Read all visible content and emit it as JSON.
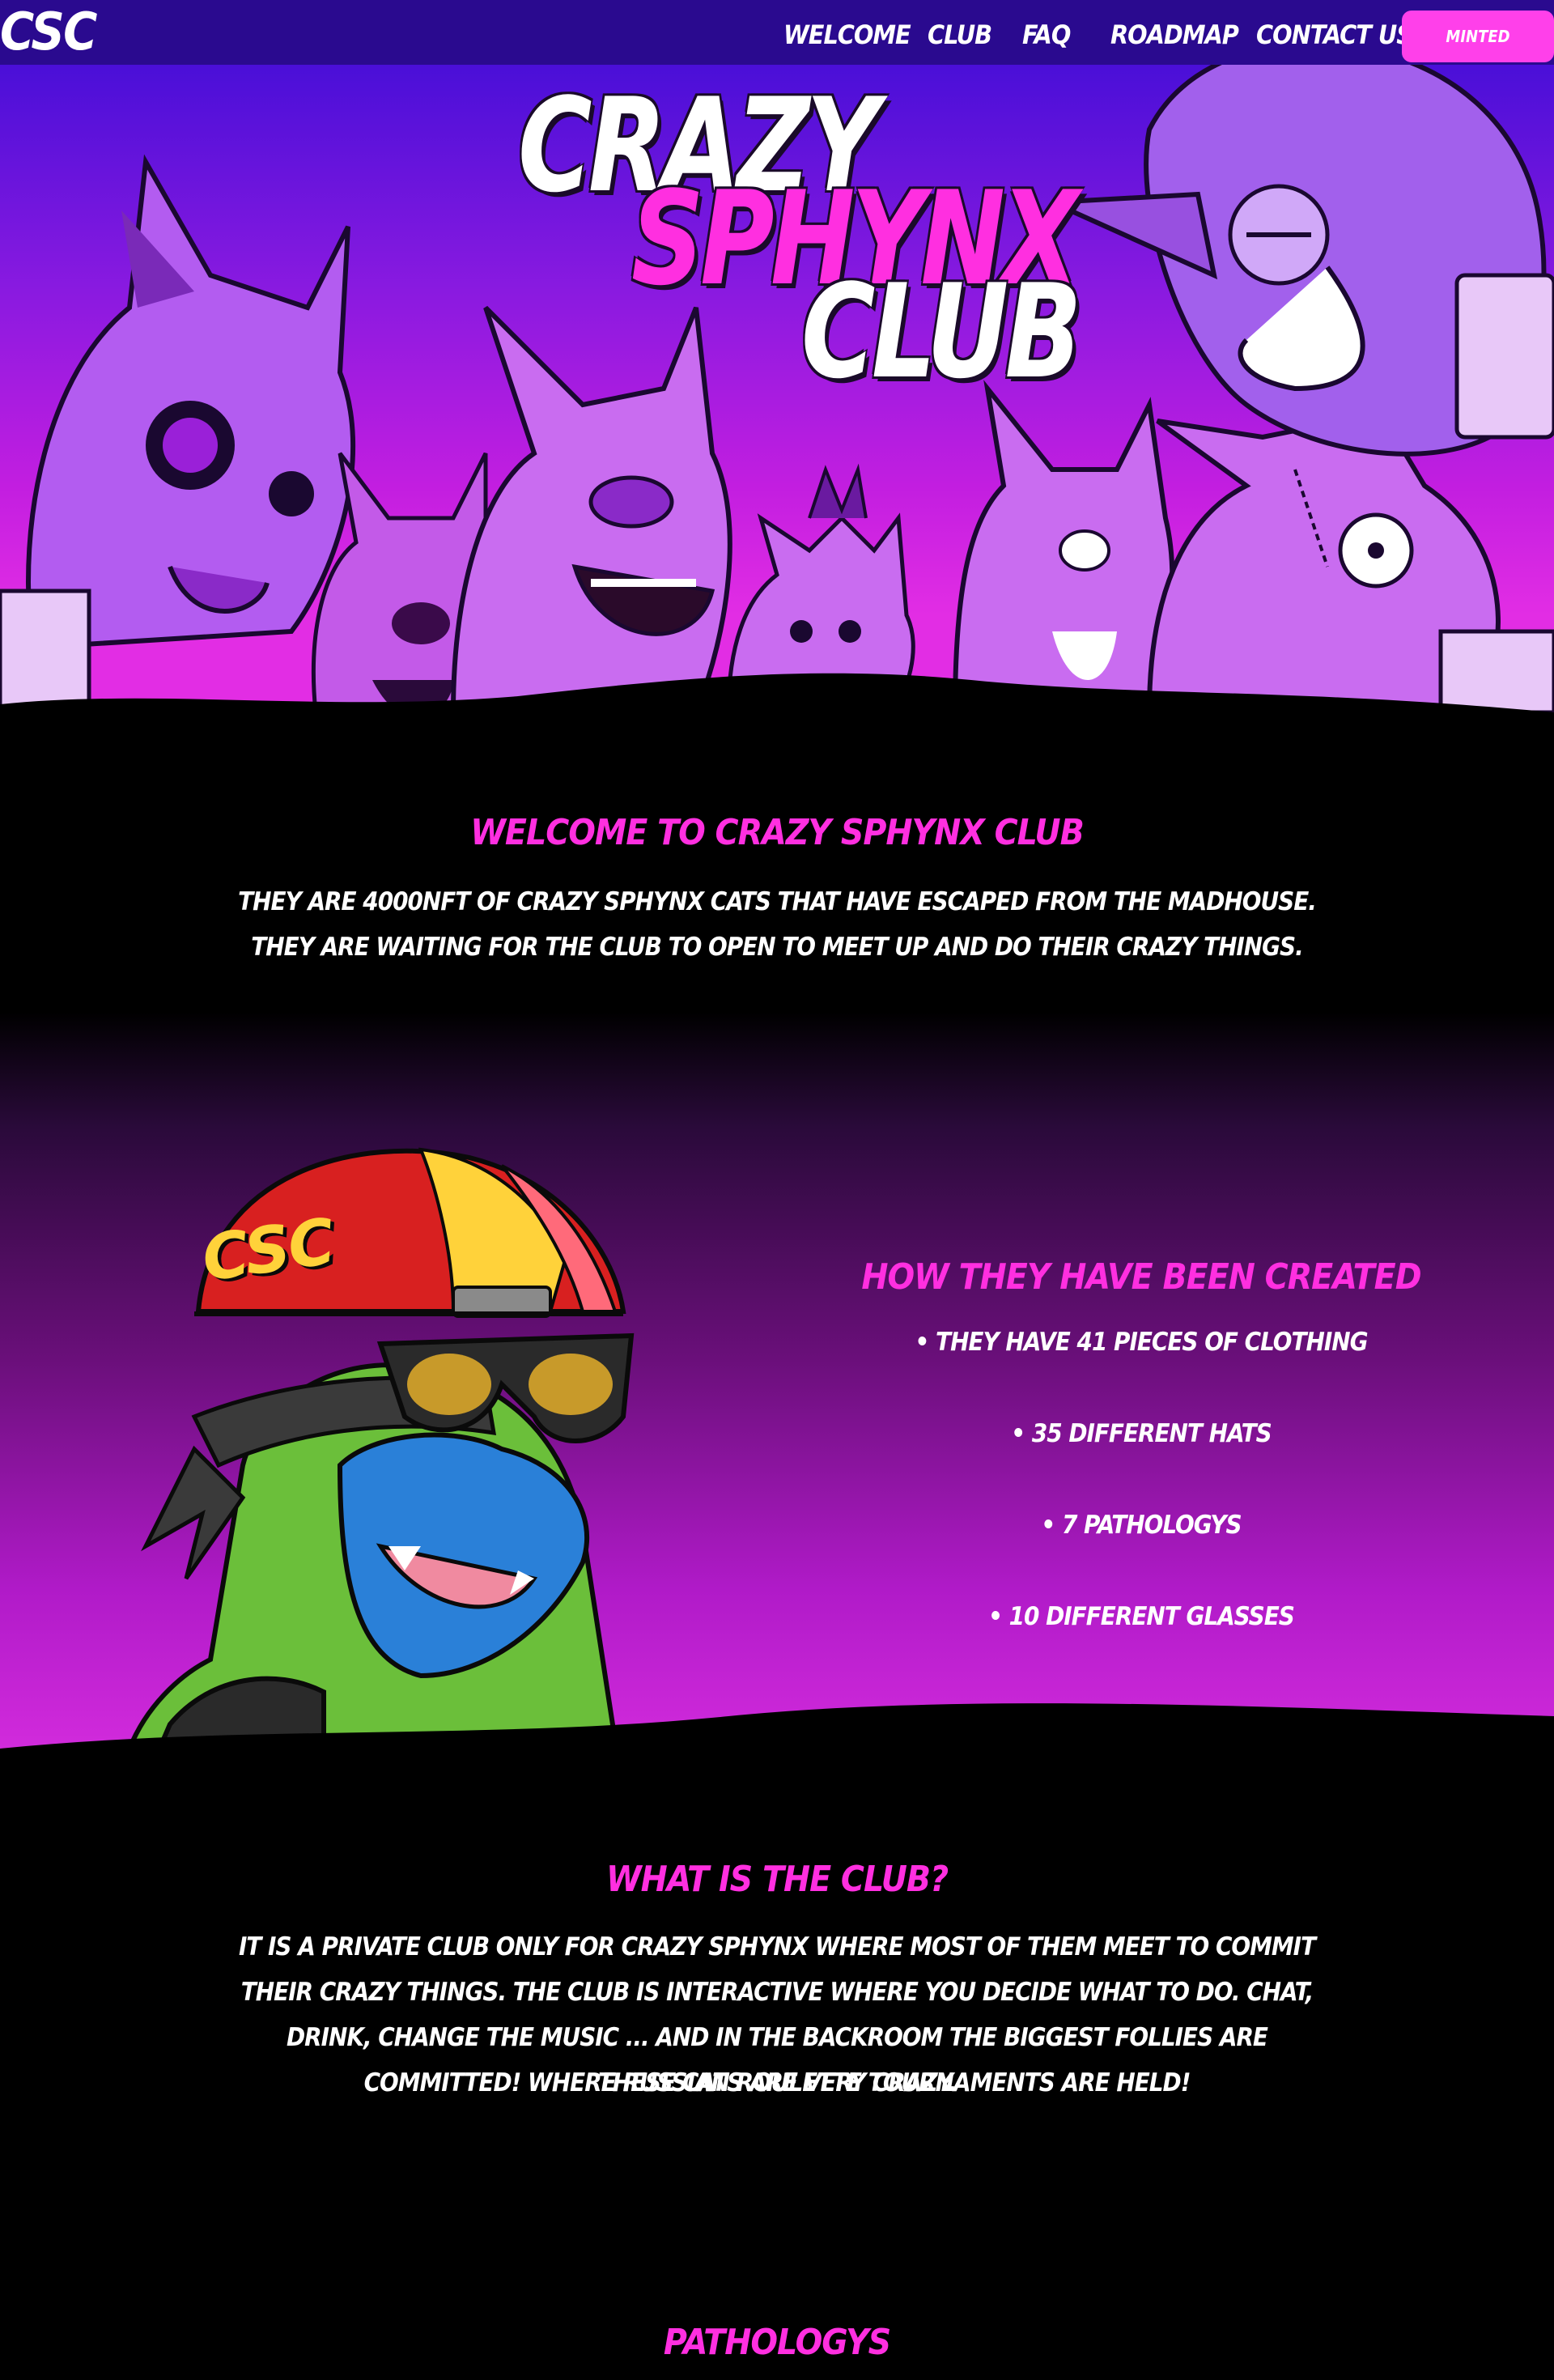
{
  "nav": {
    "logo": "CSC",
    "links": [
      "WELCOME",
      "CLUB",
      "FAQ",
      "ROADMAP",
      "CONTACT US"
    ],
    "button": "MINTED"
  },
  "hero": {
    "title_line1": "CRAZY",
    "title_line2": "SPHYNX",
    "title_line3": "CLUB",
    "helmet_letters": "CSC"
  },
  "welcome": {
    "heading": "WELCOME TO CRAZY SPHYNX CLUB",
    "text": "THEY ARE 4000NFT OF CRAZY SPHYNX CATS THAT HAVE ESCAPED FROM THE MADHOUSE. THEY ARE WAITING FOR THE CLUB TO OPEN TO MEET UP AND DO THEIR CRAZY THINGS."
  },
  "created": {
    "heading": "HOW THEY HAVE BEEN CREATED",
    "items": [
      "THEY HAVE 41 PIECES OF CLOTHING",
      "35 DIFFERENT HATS",
      "7 PATHOLOGYS",
      "10 DIFFERENT GLASSES"
    ]
  },
  "club": {
    "heading": "WHAT IS THE CLUB?",
    "text": "IT IS A PRIVATE CLUB ONLY FOR CRAZY SPHYNX WHERE MOST OF THEM MEET TO COMMIT THEIR CRAZY THINGS. THE CLUB IS INTERACTIVE WHERE YOU DECIDE WHAT TO DO. CHAT, DRINK, CHANGE THE MUSIC ... AND IN THE BACKROOM THE BIGGEST FOLLIES ARE COMMITTED! WHERE RUSSIAN ROULETTE TOURNAMENTS ARE HELD!",
    "text2": "THESE CATS ARE VERY CRAZY."
  },
  "pathologys": {
    "heading": "PATHOLOGYS"
  },
  "colors": {
    "nav_bg": "#2a0a8f",
    "accent_pink": "#ff2fe0",
    "button_pink": "#ff40ea",
    "page_bg": "#000000"
  }
}
